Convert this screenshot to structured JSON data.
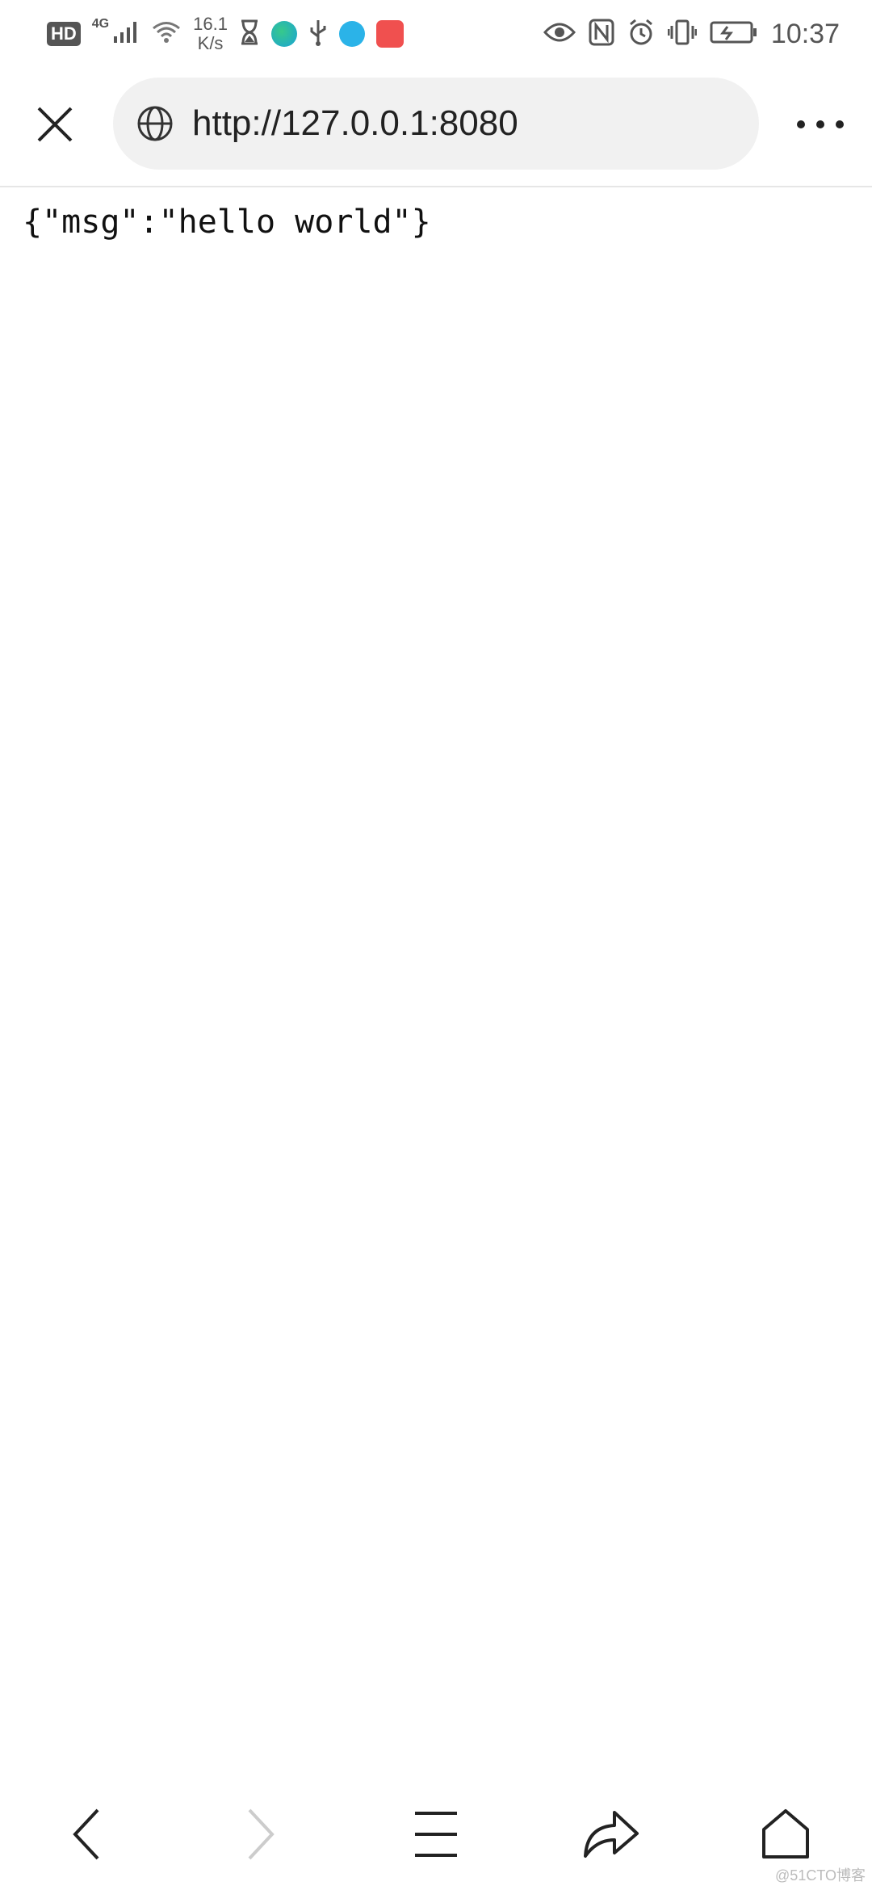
{
  "status_bar": {
    "hd_label": "HD",
    "network_label": "4G",
    "speed_value": "16.1",
    "speed_unit": "K/s",
    "time": "10:37"
  },
  "browser": {
    "url": "http://127.0.0.1:8080"
  },
  "page": {
    "body_text": "{\"msg\":\"hello world\"}"
  },
  "bottom_nav": {
    "items": [
      "back-icon",
      "forward-icon",
      "menu-icon",
      "share-icon",
      "home-icon"
    ]
  },
  "watermark": "@51CTO博客",
  "colors": {
    "icon_dark": "#222222",
    "icon_disabled": "#cccccc",
    "url_bar_bg": "#f1f1f1",
    "status_grey": "#555555"
  }
}
